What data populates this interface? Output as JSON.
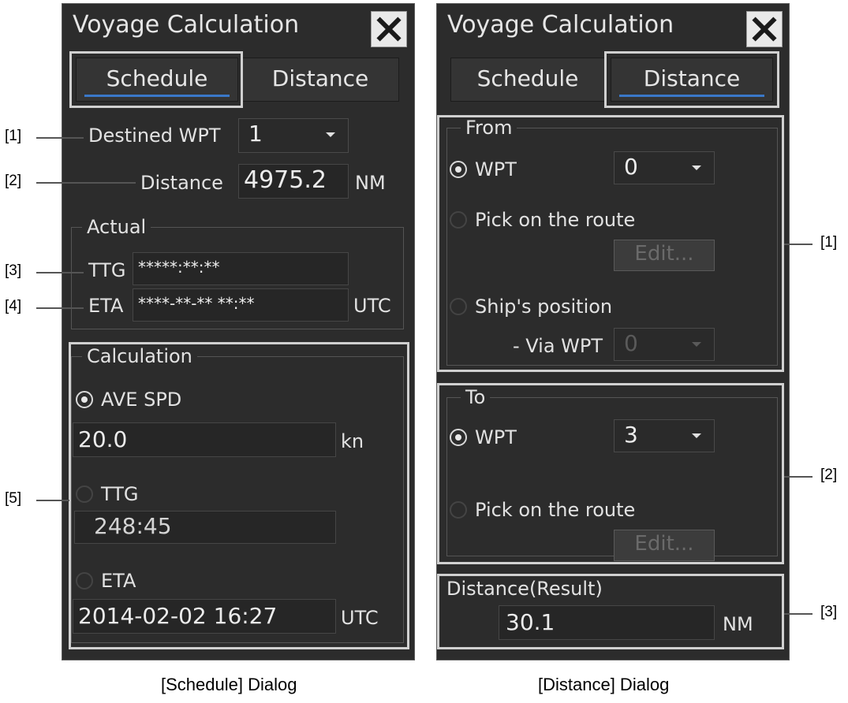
{
  "schedule": {
    "title": "Voyage Calculation",
    "tabs": {
      "schedule": "Schedule",
      "distance": "Distance"
    },
    "destined_wpt_label": "Destined WPT",
    "destined_wpt_value": "1",
    "distance_label": "Distance",
    "distance_value": "4975.2",
    "distance_unit": "NM",
    "actual": {
      "group_title": "Actual",
      "ttg_label": "TTG",
      "ttg_value": "*****:**:**",
      "eta_label": "ETA",
      "eta_value": "****-**-** **:**",
      "eta_unit": "UTC"
    },
    "calculation": {
      "group_title": "Calculation",
      "ave_spd_label": "AVE SPD",
      "ave_spd_value": "20.0",
      "ave_spd_unit": "kn",
      "ttg_label": "TTG",
      "ttg_value": "248:45",
      "eta_label": "ETA",
      "eta_value": "2014-02-02 16:27",
      "eta_unit": "UTC",
      "selected": "AVE SPD"
    },
    "caption": "[Schedule] Dialog",
    "annotations": {
      "a1": "[1]",
      "a2": "[2]",
      "a3": "[3]",
      "a4": "[4]",
      "a5": "[5]"
    }
  },
  "distance": {
    "title": "Voyage Calculation",
    "tabs": {
      "schedule": "Schedule",
      "distance": "Distance"
    },
    "from": {
      "group_title": "From",
      "wpt_label": "WPT",
      "wpt_value": "0",
      "pick_label": "Pick on the route",
      "edit_label": "Edit...",
      "ship_label": "Ship's position",
      "via_label": "- Via WPT",
      "via_value": "0",
      "selected": "WPT"
    },
    "to": {
      "group_title": "To",
      "wpt_label": "WPT",
      "wpt_value": "3",
      "pick_label": "Pick on the route",
      "edit_label": "Edit...",
      "selected": "WPT"
    },
    "result": {
      "label": "Distance(Result)",
      "value": "30.1",
      "unit": "NM"
    },
    "caption": "[Distance] Dialog",
    "annotations": {
      "a1": "[1]",
      "a2": "[2]",
      "a3": "[3]"
    }
  },
  "colors": {
    "panel_bg": "#2c2c2c",
    "tab_underline": "#3a78c8",
    "highlight_frame": "#d0d0d0"
  },
  "icons": {
    "close": "close-icon",
    "dropdown": "chevron-down-icon",
    "radio": "radio-button"
  }
}
